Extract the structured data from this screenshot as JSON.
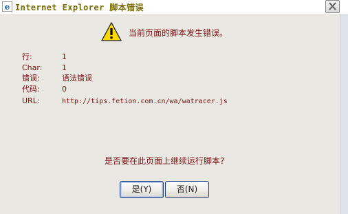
{
  "window": {
    "title": "Internet Explorer 脚本错误"
  },
  "dialog": {
    "headline": "当前页面的脚本发生错误。",
    "details": [
      {
        "label": "行:",
        "value": "1"
      },
      {
        "label": "Char:",
        "value": "1"
      },
      {
        "label": "错误:",
        "value": "语法错误"
      },
      {
        "label": "代码:",
        "value": "0"
      },
      {
        "label": "URL:",
        "value": "http://tips.fetion.com.cn/wa/watracer.js"
      }
    ],
    "question": "是否要在此页面上继续运行脚本?",
    "yes_label": "是(Y)",
    "no_label": "否(N)"
  },
  "icons": {
    "title": "ie-icon",
    "message": "warning-icon",
    "close": "close-icon"
  }
}
